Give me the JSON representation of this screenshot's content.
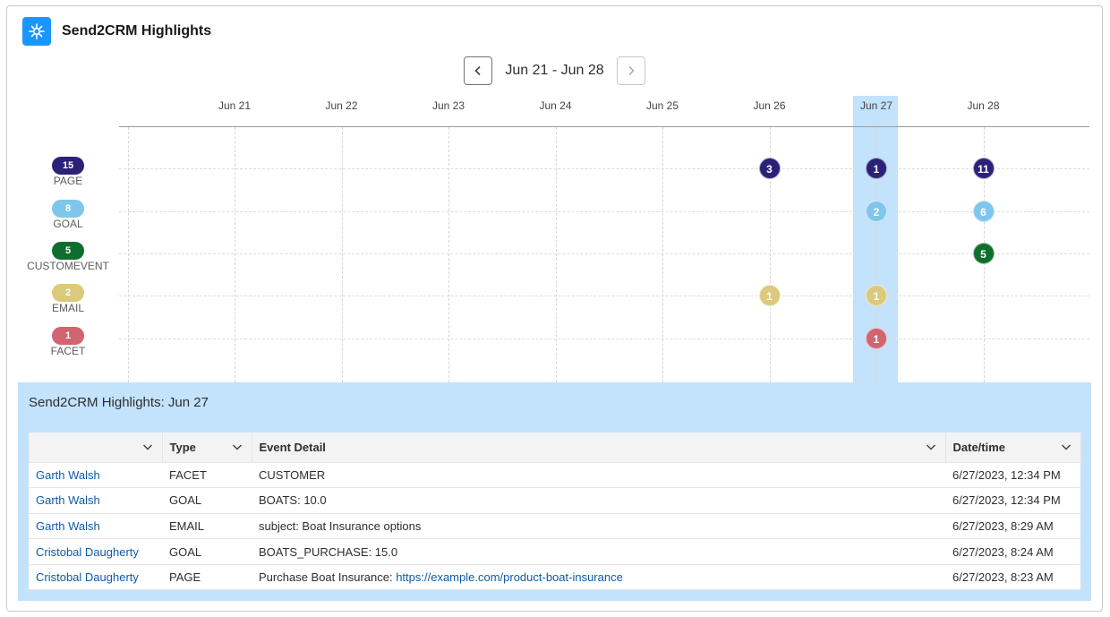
{
  "header": {
    "title": "Send2CRM Highlights",
    "icon": "sparkle-icon"
  },
  "nav": {
    "range": "Jun 21 - Jun 28",
    "prev_icon": "chevron-left-icon",
    "next_icon": "chevron-right-icon"
  },
  "dates": [
    "Jun 21",
    "Jun 22",
    "Jun 23",
    "Jun 24",
    "Jun 25",
    "Jun 26",
    "Jun 27",
    "Jun 28"
  ],
  "selected_date": "Jun 27",
  "legend": [
    {
      "count": "15",
      "label": "PAGE",
      "color": "#2b2277"
    },
    {
      "count": "8",
      "label": "GOAL",
      "color": "#7fc6ec"
    },
    {
      "count": "5",
      "label": "CUSTOMEVENT",
      "color": "#0f6e2e"
    },
    {
      "count": "2",
      "label": "EMAIL",
      "color": "#dcc97b"
    },
    {
      "count": "1",
      "label": "FACET",
      "color": "#d0646f"
    }
  ],
  "chart_data": {
    "type": "scatter",
    "categories": [
      "Jun 21",
      "Jun 22",
      "Jun 23",
      "Jun 24",
      "Jun 25",
      "Jun 26",
      "Jun 27",
      "Jun 28"
    ],
    "series": [
      {
        "name": "PAGE",
        "points": [
          {
            "x": "Jun 26",
            "value": 3
          },
          {
            "x": "Jun 27",
            "value": 1
          },
          {
            "x": "Jun 28",
            "value": 11
          }
        ]
      },
      {
        "name": "GOAL",
        "points": [
          {
            "x": "Jun 27",
            "value": 2
          },
          {
            "x": "Jun 28",
            "value": 6
          }
        ]
      },
      {
        "name": "CUSTOMEVENT",
        "points": [
          {
            "x": "Jun 28",
            "value": 5
          }
        ]
      },
      {
        "name": "EMAIL",
        "points": [
          {
            "x": "Jun 26",
            "value": 1
          },
          {
            "x": "Jun 27",
            "value": 1
          }
        ]
      },
      {
        "name": "FACET",
        "points": [
          {
            "x": "Jun 27",
            "value": 1
          }
        ]
      }
    ]
  },
  "detail": {
    "title": "Send2CRM Highlights: Jun 27",
    "columns": [
      "",
      "Type",
      "Event Detail",
      "Date/time"
    ],
    "rows": [
      {
        "name": "Garth Walsh",
        "type": "FACET",
        "detail": "CUSTOMER",
        "link": "",
        "datetime": "6/27/2023, 12:34 PM"
      },
      {
        "name": "Garth Walsh",
        "type": "GOAL",
        "detail": "BOATS: 10.0",
        "link": "",
        "datetime": "6/27/2023, 12:34 PM"
      },
      {
        "name": "Garth Walsh",
        "type": "EMAIL",
        "detail": "subject: Boat Insurance options",
        "link": "",
        "datetime": "6/27/2023, 8:29 AM"
      },
      {
        "name": "Cristobal Daugherty",
        "type": "GOAL",
        "detail": "BOATS_PURCHASE: 15.0",
        "link": "",
        "datetime": "6/27/2023, 8:24 AM"
      },
      {
        "name": "Cristobal Daugherty",
        "type": "PAGE",
        "detail": "Purchase Boat Insurance: ",
        "link": "https://example.com/product-boat-insurance",
        "datetime": "6/27/2023, 8:23 AM"
      }
    ]
  }
}
